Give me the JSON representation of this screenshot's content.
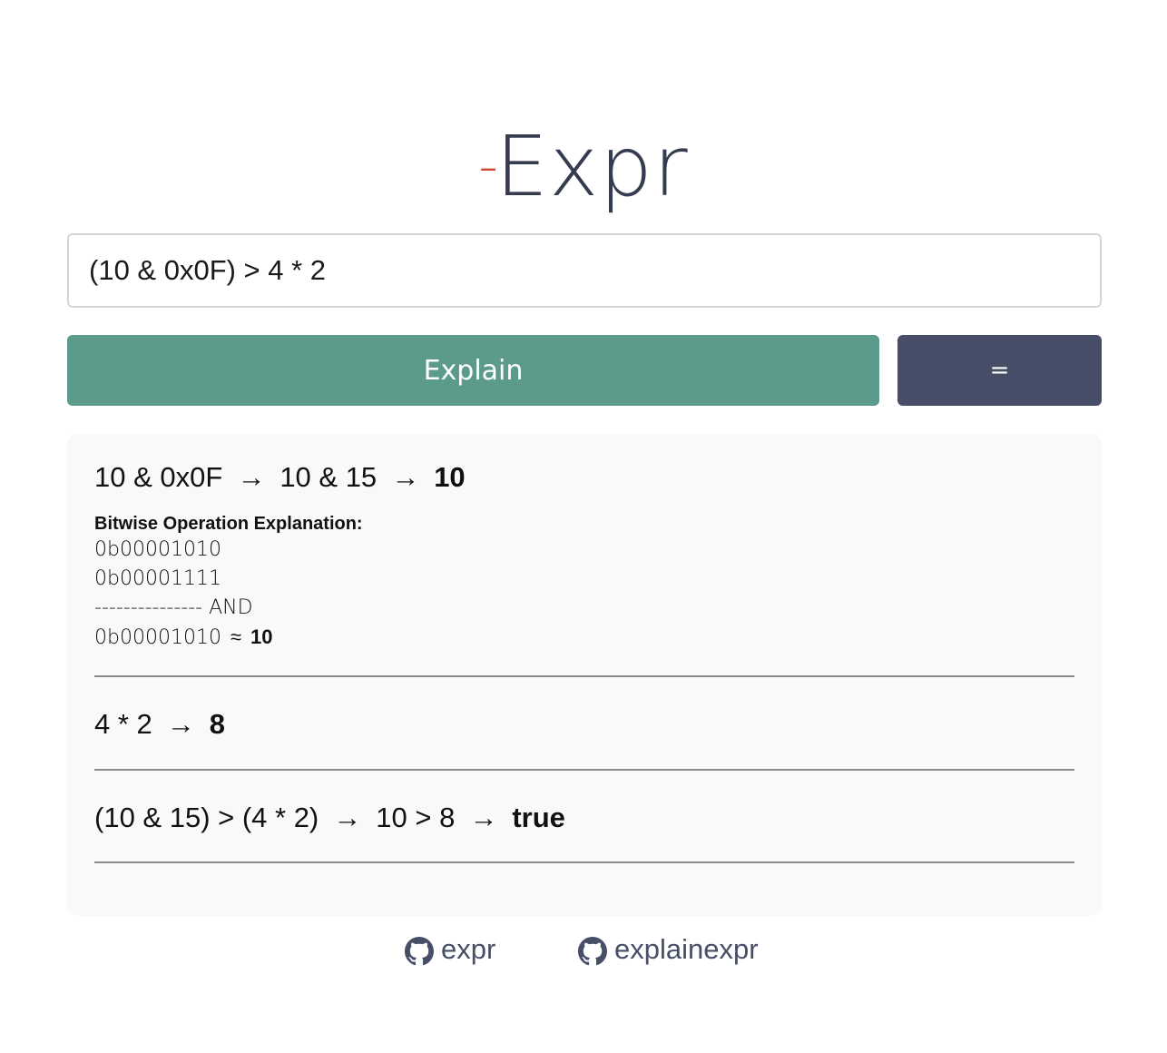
{
  "logo": {
    "dash": "-",
    "text": "Expr"
  },
  "input": {
    "value": "(10 & 0x0F) > 4 * 2"
  },
  "buttons": {
    "explain": "Explain",
    "evaluate": "="
  },
  "steps": [
    {
      "parts": [
        "10 & 0x0F",
        "10 & 15"
      ],
      "result": "10",
      "bitwise": {
        "title": "Bitwise Operation Explanation:",
        "operand_a": "0b00001010",
        "operand_b": "0b00001111",
        "separator": "--------------- AND",
        "output": "0b00001010",
        "approx_symbol": "≈",
        "output_value": "10"
      }
    },
    {
      "parts": [
        "4 * 2"
      ],
      "result": "8"
    },
    {
      "parts": [
        "(10 & 15) > (4 * 2)",
        "10 > 8"
      ],
      "result": "true"
    }
  ],
  "arrow": "→",
  "footer": {
    "links": [
      {
        "label": "expr",
        "icon": "github-icon"
      },
      {
        "label": "explainexpr",
        "icon": "github-icon"
      }
    ]
  },
  "colors": {
    "logo_text": "#363c50",
    "logo_dash": "#d64530",
    "explain_button": "#5c9a8b",
    "evaluate_button": "#464f67",
    "panel_background": "#f9f9f9",
    "footer_link": "#464f67"
  }
}
